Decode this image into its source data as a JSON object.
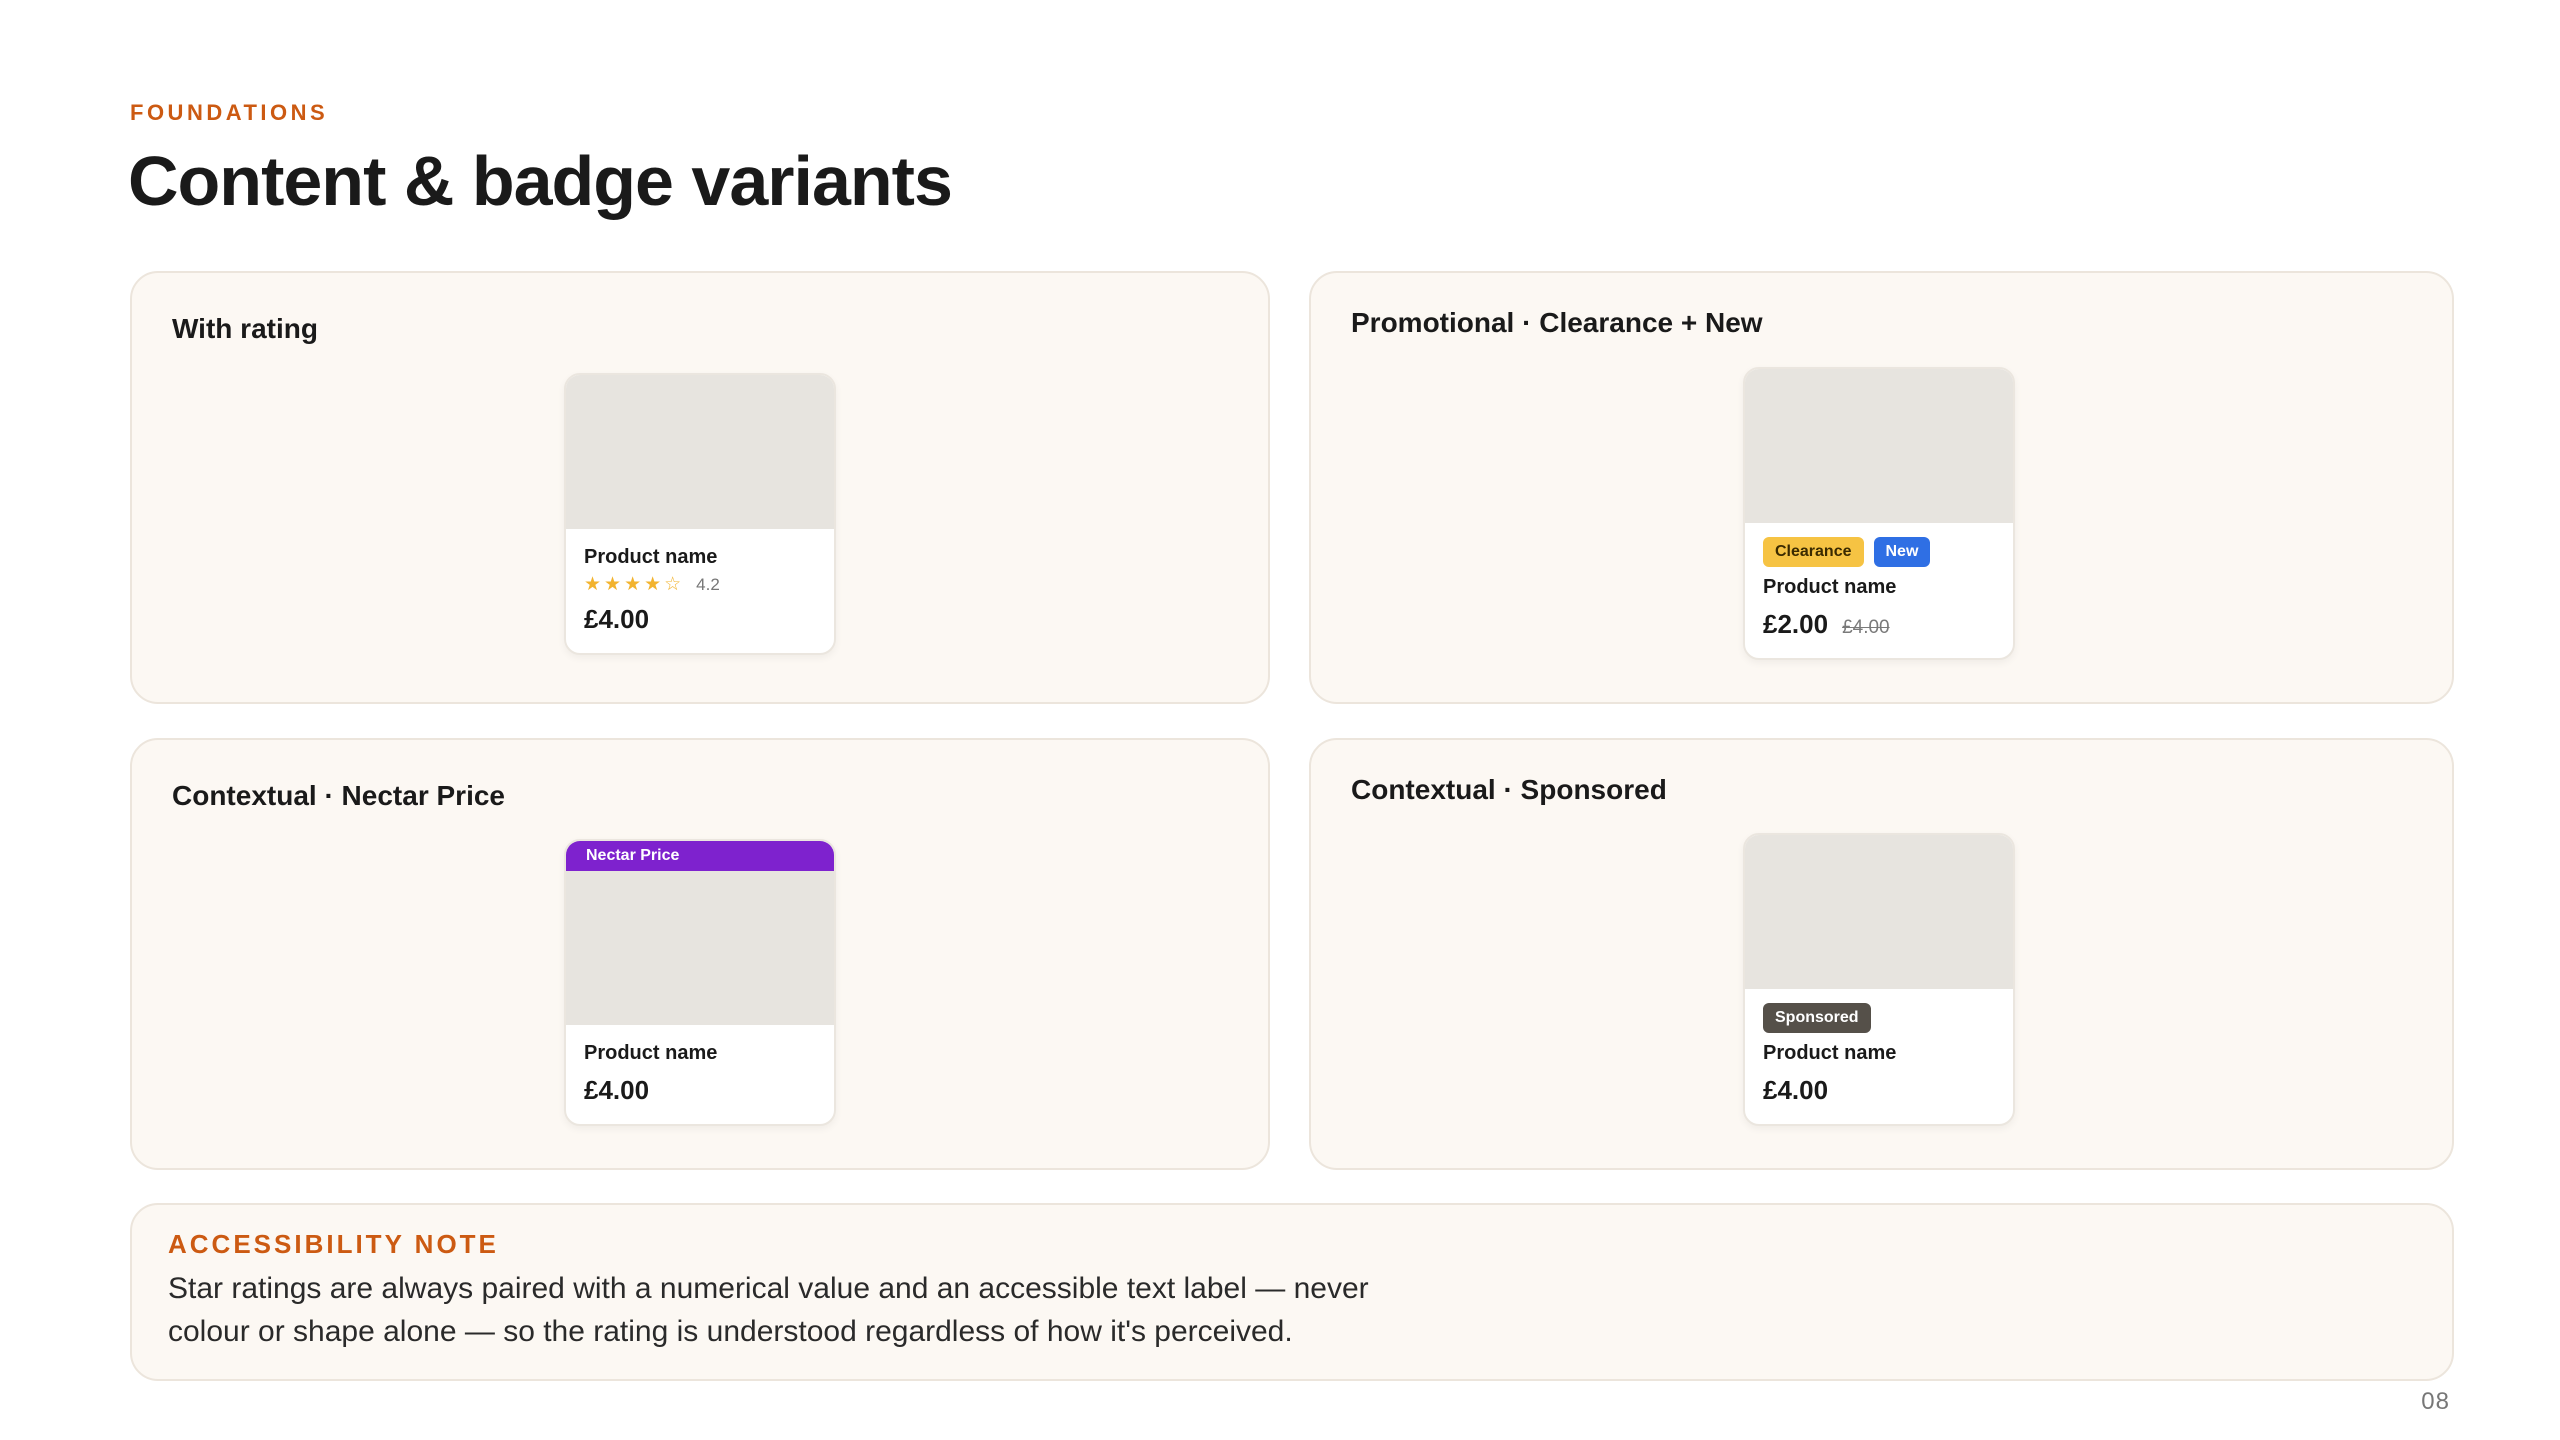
{
  "header": {
    "eyebrow": "FOUNDATIONS",
    "title": "Content & badge variants"
  },
  "panels": [
    {
      "title": "With rating",
      "card": {
        "product_name": "Product name",
        "stars": "★★★★☆",
        "rating": "4.2",
        "price": "£4.00"
      }
    },
    {
      "title": "Promotional · Clearance + New",
      "card": {
        "badges": [
          "Clearance",
          "New"
        ],
        "product_name": "Product name",
        "price": "£2.00",
        "was_price": "£4.00"
      }
    },
    {
      "title": "Contextual · Nectar Price",
      "card": {
        "strip_label": "Nectar Price",
        "product_name": "Product name",
        "price": "£4.00"
      }
    },
    {
      "title": "Contextual · Sponsored",
      "card": {
        "badge": "Sponsored",
        "product_name": "Product name",
        "price": "£4.00"
      }
    }
  ],
  "accessibility_note": {
    "title": "ACCESSIBILITY NOTE",
    "text": "Star ratings are always paired with a numerical value and an accessible text label — never colour or shape alone — so the rating is understood regardless of how it's perceived."
  },
  "page_number": "08",
  "colors": {
    "accent_orange": "#cc5a12",
    "nectar_purple": "#7e22ce",
    "clearance_yellow": "#f6c343",
    "new_blue": "#2f6fe4",
    "sponsored_grey": "#555049",
    "star_gold": "#f2b32e",
    "panel_bg": "#fcf8f3",
    "image_placeholder": "#e7e4df"
  }
}
